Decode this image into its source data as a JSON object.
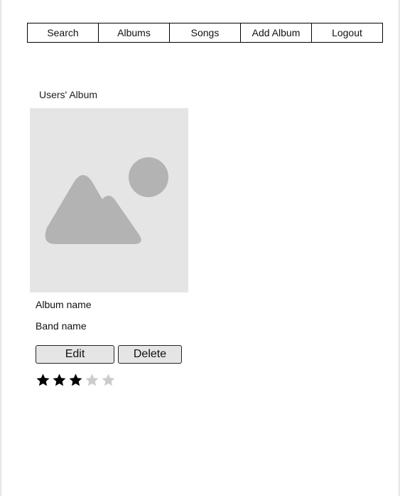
{
  "nav": {
    "items": [
      {
        "id": "search",
        "label": "Search"
      },
      {
        "id": "albums",
        "label": "Albums"
      },
      {
        "id": "songs",
        "label": "Songs"
      },
      {
        "id": "add-album",
        "label": "Add Album"
      },
      {
        "id": "logout",
        "label": "Logout"
      }
    ]
  },
  "section": {
    "title": "Users' Album"
  },
  "album": {
    "image_icon": "image-placeholder-icon",
    "name": "Album name",
    "band": "Band name",
    "edit_label": "Edit",
    "delete_label": "Delete",
    "rating": {
      "value": 3,
      "max": 5,
      "filled_color": "#000000",
      "empty_color": "#cccccc"
    }
  }
}
